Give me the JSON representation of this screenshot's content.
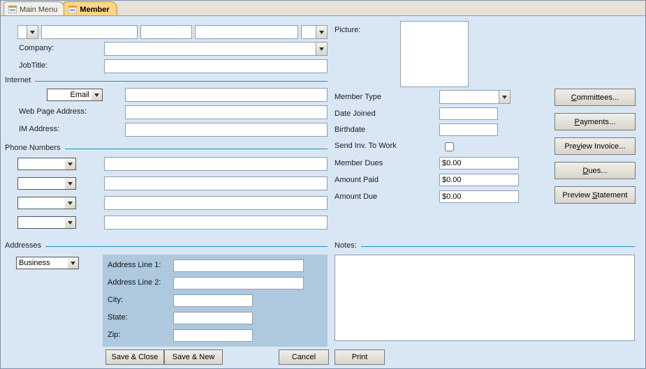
{
  "tabs": {
    "main_menu": "Main Menu",
    "member": "Member"
  },
  "labels": {
    "company": "Company:",
    "job_title": "JobTitle:",
    "internet": "Internet",
    "email": "Email",
    "web_page": "Web Page Address:",
    "im_address": "IM Address:",
    "phone_numbers": "Phone Numbers",
    "addresses": "Addresses",
    "address_type": "Business",
    "address_line1": "Address Line 1:",
    "address_line2": "Address Line 2:",
    "city": "City:",
    "state": "State:",
    "zip": "Zip:",
    "picture": "Picture:",
    "member_type": "Member Type",
    "date_joined": "Date Joined",
    "birthdate": "Birthdate",
    "send_inv": "Send Inv. To Work",
    "member_dues": "Member Dues",
    "amount_paid": "Amount Paid",
    "amount_due": "Amount Due",
    "notes": "Notes:"
  },
  "values": {
    "salutation": "",
    "first_name": "",
    "middle_name": "",
    "last_name": "",
    "suffix": "",
    "company": "",
    "job_title": "",
    "email_type": "Email",
    "email": "",
    "web_page": "",
    "im_address": "",
    "phone1_type": "",
    "phone1": "",
    "phone2_type": "",
    "phone2": "",
    "phone3_type": "",
    "phone3": "",
    "phone4_type": "",
    "phone4": "",
    "address_type": "Business",
    "address_line1": "",
    "address_line2": "",
    "city": "",
    "state": "",
    "zip": "",
    "member_type": "",
    "date_joined": "",
    "birthdate": "",
    "member_dues": "$0.00",
    "amount_paid": "$0.00",
    "amount_due": "$0.00",
    "notes": ""
  },
  "buttons": {
    "committees": {
      "pre": "",
      "u": "C",
      "post": "ommittees..."
    },
    "payments": {
      "pre": "",
      "u": "P",
      "post": "ayments..."
    },
    "preview_invoice": {
      "pre": "Pre",
      "u": "v",
      "post": "iew Invoice..."
    },
    "dues": {
      "pre": "",
      "u": "D",
      "post": "ues..."
    },
    "preview_statement": {
      "pre": "Preview ",
      "u": "S",
      "post": "tatement"
    },
    "save_close": "Save & Close",
    "save_new": "Save & New",
    "cancel": "Cancel",
    "print": "Print"
  }
}
